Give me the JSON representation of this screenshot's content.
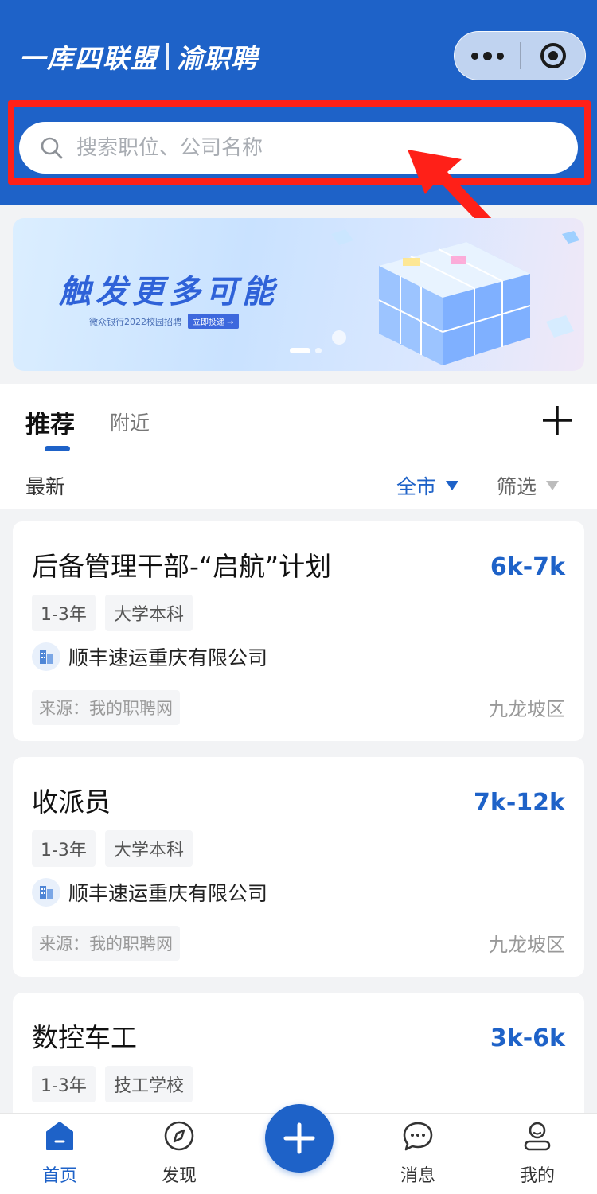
{
  "header": {
    "brand_left": "一库四联盟",
    "brand_right": "渝职聘"
  },
  "search": {
    "placeholder": "搜索职位、公司名称"
  },
  "banner": {
    "title": "触发更多可能",
    "subtitle": "微众银行2022校园招聘",
    "cta": "立即投递 →"
  },
  "tabs": {
    "active": "推荐",
    "other": "附近"
  },
  "filters": {
    "latest": "最新",
    "city": "全市",
    "filter": "筛选"
  },
  "jobs": [
    {
      "title": "后备管理干部-“启航”计划",
      "salary": "6k-7k",
      "experience": "1-3年",
      "education": "大学本科",
      "company": "顺丰速运重庆有限公司",
      "source": "来源：我的职聘网",
      "district": "九龙坡区"
    },
    {
      "title": "收派员",
      "salary": "7k-12k",
      "experience": "1-3年",
      "education": "大学本科",
      "company": "顺丰速运重庆有限公司",
      "source": "来源：我的职聘网",
      "district": "九龙坡区"
    },
    {
      "title": "数控车工",
      "salary": "3k-6k",
      "experience": "1-3年",
      "education": "技工学校"
    }
  ],
  "nav": {
    "home": "首页",
    "discover": "发现",
    "messages": "消息",
    "mine": "我的"
  },
  "colors": {
    "brand_blue": "#1e62c8",
    "highlight_red": "#ff2018"
  }
}
